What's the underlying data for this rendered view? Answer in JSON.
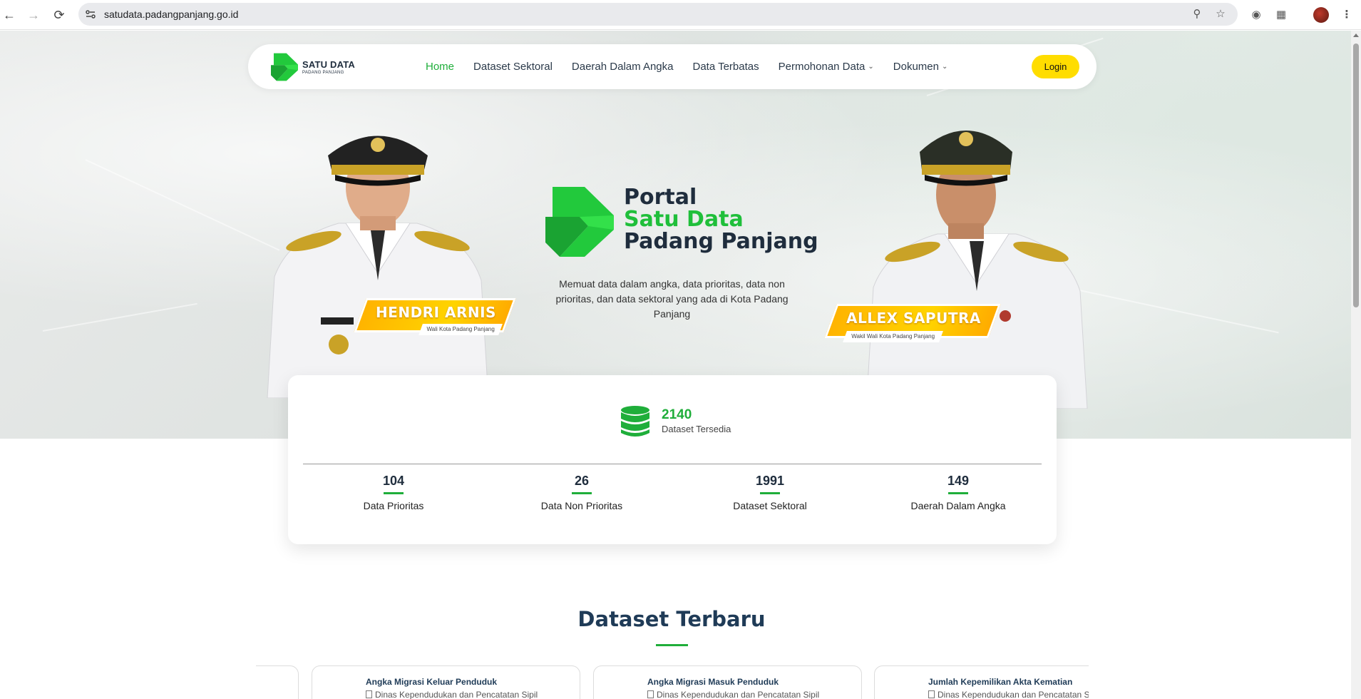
{
  "browser": {
    "url": "satudata.padangpanjang.go.id",
    "back_icon": "arrow-left",
    "forward_icon": "arrow-right",
    "reload_icon": "reload",
    "zoom_icon": "magnifier",
    "bookmark_icon": "star",
    "camera_icon": "camera",
    "extensions_icon": "puzzle",
    "menu_icon": "kebab"
  },
  "brand": {
    "name": "SATU DATA",
    "sub": "PADANG PANJANG",
    "accent": "#1fae3a"
  },
  "nav": {
    "items": [
      {
        "label": "Home",
        "active": true
      },
      {
        "label": "Dataset Sektoral"
      },
      {
        "label": "Daerah Dalam Angka"
      },
      {
        "label": "Data Terbatas"
      },
      {
        "label": "Permohonan Data",
        "dropdown": true
      },
      {
        "label": "Dokumen",
        "dropdown": true
      }
    ],
    "login": "Login",
    "login_color": "#ffdd00"
  },
  "hero": {
    "title_line1": "Portal",
    "title_line2": "Satu Data",
    "title_line3": "Padang Panjang",
    "description": "Memuat data dalam angka, data prioritas, data non prioritas, dan data sektoral yang ada di Kota Padang Panjang",
    "left_person": {
      "name": "HENDRI ARNIS",
      "role": "Wali Kota Padang Panjang",
      "badge": "HENDRI ARNIS"
    },
    "right_person": {
      "name": "ALLEX SAPUTRA",
      "role": "Wakil Wali Kota Padang Panjang"
    }
  },
  "stats": {
    "total": "2140",
    "total_label": "Dataset Tersedia",
    "items": [
      {
        "value": "104",
        "label": "Data Prioritas"
      },
      {
        "value": "26",
        "label": "Data Non Prioritas"
      },
      {
        "value": "1991",
        "label": "Dataset Sektoral"
      },
      {
        "value": "149",
        "label": "Daerah Dalam Angka"
      }
    ]
  },
  "latest": {
    "title": "Dataset Terbaru",
    "cards": [
      {
        "title": "Angka Migrasi Keluar Penduduk",
        "org": "Dinas Kependudukan dan Pencatatan Sipil"
      },
      {
        "title": "Angka Migrasi Masuk Penduduk",
        "org": "Dinas Kependudukan dan Pencatatan Sipil"
      },
      {
        "title": "Jumlah Kepemilikan Akta Kematian",
        "org": "Dinas Kependudukan dan Pencatatan Sipil"
      }
    ]
  }
}
